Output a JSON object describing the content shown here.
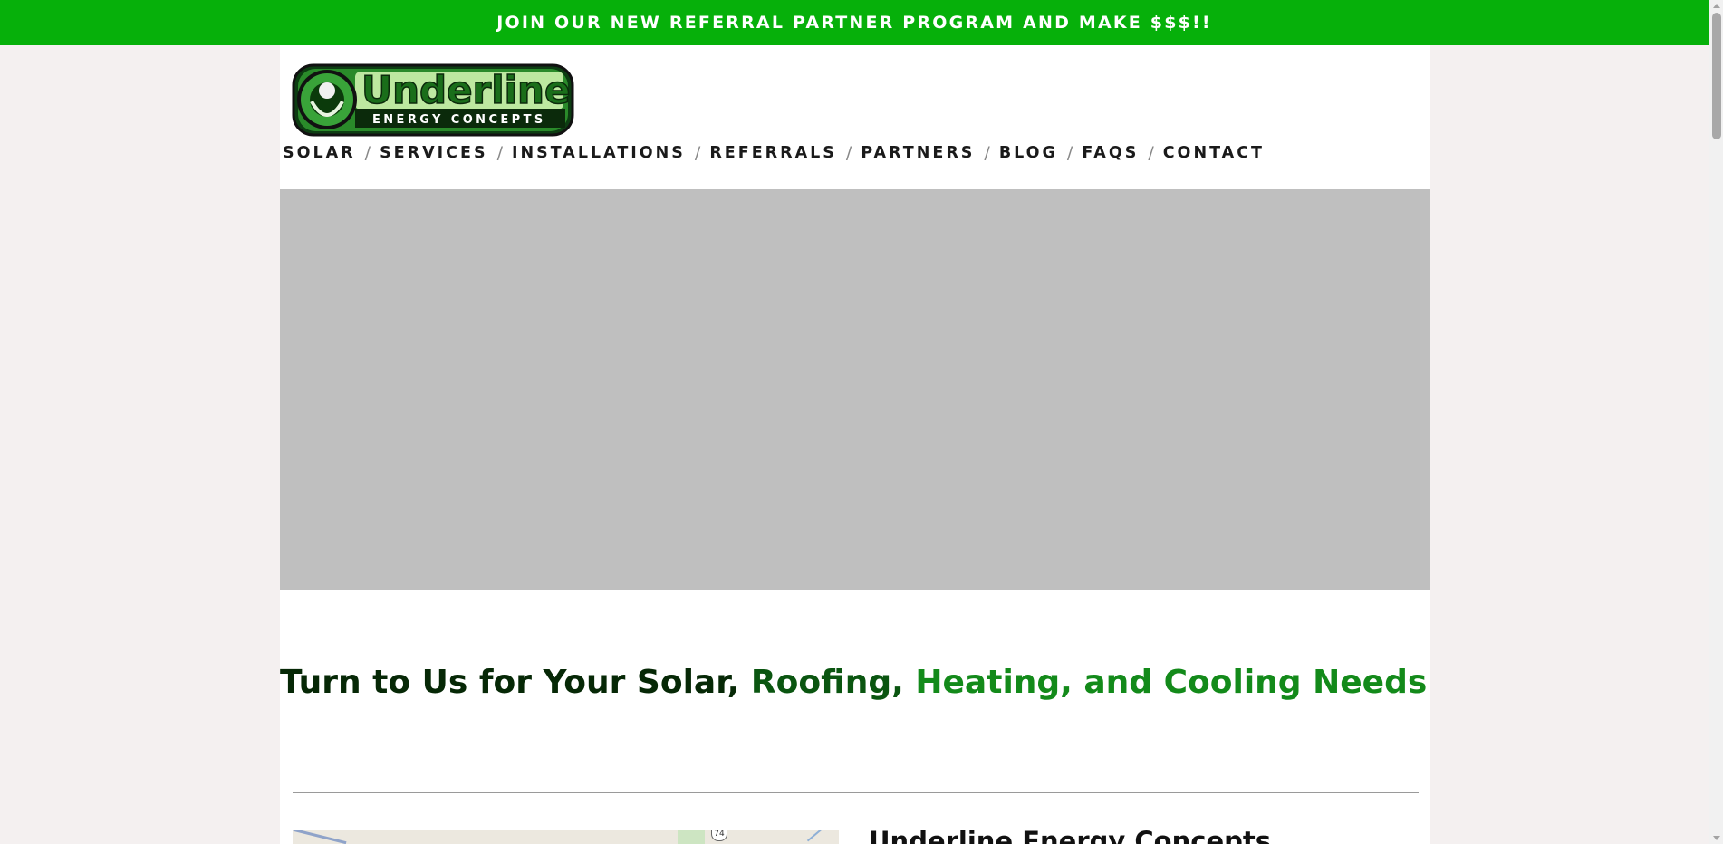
{
  "banner": {
    "text": "JOIN OUR NEW REFERRAL PARTNER PROGRAM AND MAKE $$$!!"
  },
  "logo": {
    "name": "Underline",
    "tagline": "ENERGY CONCEPTS"
  },
  "nav": {
    "separator": "/",
    "items": [
      "SOLAR",
      "SERVICES",
      "INSTALLATIONS",
      "REFERRALS",
      "PARTNERS",
      "BLOG",
      "FAQS",
      "CONTACT"
    ]
  },
  "headline": {
    "part1": "Turn to Us for Your Solar,",
    "part2": "Roofing,",
    "part3": "Heating, and Cooling Needs!"
  },
  "map": {
    "route_badge": "74"
  },
  "company": {
    "name": "Underline Energy Concepts"
  },
  "colors": {
    "banner": "#06b00a",
    "headline_dark": "#062806",
    "headline_mid": "#0a5510",
    "headline_bright": "#138a1a",
    "hero_placeholder": "#bfbfbf"
  }
}
